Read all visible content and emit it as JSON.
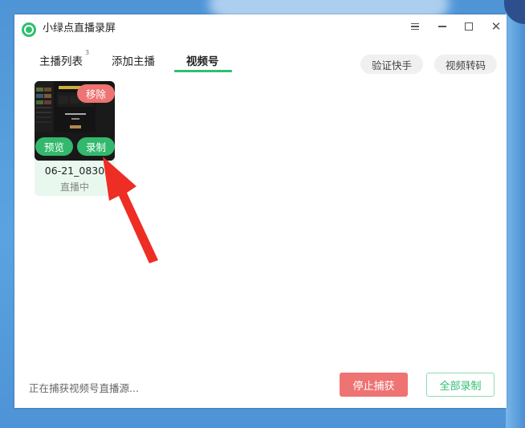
{
  "window": {
    "title": "小绿点直播录屏",
    "accent_color": "#2fbf71",
    "danger_color": "#ee7373"
  },
  "tabs": [
    {
      "label": "主播列表",
      "count": "3"
    },
    {
      "label": "添加主播"
    },
    {
      "label": "视频号",
      "active": true
    }
  ],
  "toolbar": {
    "verify_label": "验证快手",
    "transcode_label": "视频转码"
  },
  "card": {
    "name": "06-21_0830",
    "status": "直播中",
    "remove_label": "移除",
    "preview_label": "预览",
    "record_label": "录制"
  },
  "footer": {
    "status_text": "正在捕获视频号直播源...",
    "stop_label": "停止捕获",
    "record_all_label": "全部录制"
  },
  "icons": {
    "app": "green-ring-icon",
    "menu": "menu-icon",
    "minimize": "minimize-icon",
    "maximize": "maximize-icon",
    "close": "close-icon"
  }
}
